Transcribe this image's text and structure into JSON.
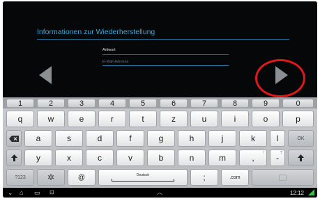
{
  "form": {
    "title": "Informationen zur Wiederherstellung",
    "answer_label": "Antwort",
    "email_placeholder": "E-Mail-Adresse"
  },
  "keyboard": {
    "number_row": [
      "1",
      "2",
      "3",
      "4",
      "5",
      "6",
      "7",
      "8",
      "9",
      "0"
    ],
    "row1": [
      "q",
      "w",
      "e",
      "r",
      "t",
      "z",
      "u",
      "i",
      "o",
      "p"
    ],
    "row2": [
      "a",
      "s",
      "d",
      "f",
      "g",
      "h",
      "j",
      "k",
      "l"
    ],
    "row3": [
      "y",
      "x",
      "c",
      "v",
      "b",
      "n",
      "m"
    ],
    "row3_punct": [
      ",",
      "-"
    ],
    "row3_punct_sub": [
      "!",
      "?"
    ],
    "ok_label": "OK",
    "mode_label": "?123",
    "at_label": "@",
    "space_label": "Deutsch",
    "semicolon_label": ";",
    "com_label": ".com"
  },
  "status": {
    "time": "12:12"
  },
  "icons": {
    "prev": "left-triangle-icon",
    "next": "right-triangle-icon",
    "backspace": "backspace-icon",
    "shift": "shift-arrow-icon",
    "settings": "gear-icon"
  },
  "colors": {
    "accent": "#3aa7d9",
    "highlight_ring": "#e01818",
    "signal": "#38c24a"
  }
}
